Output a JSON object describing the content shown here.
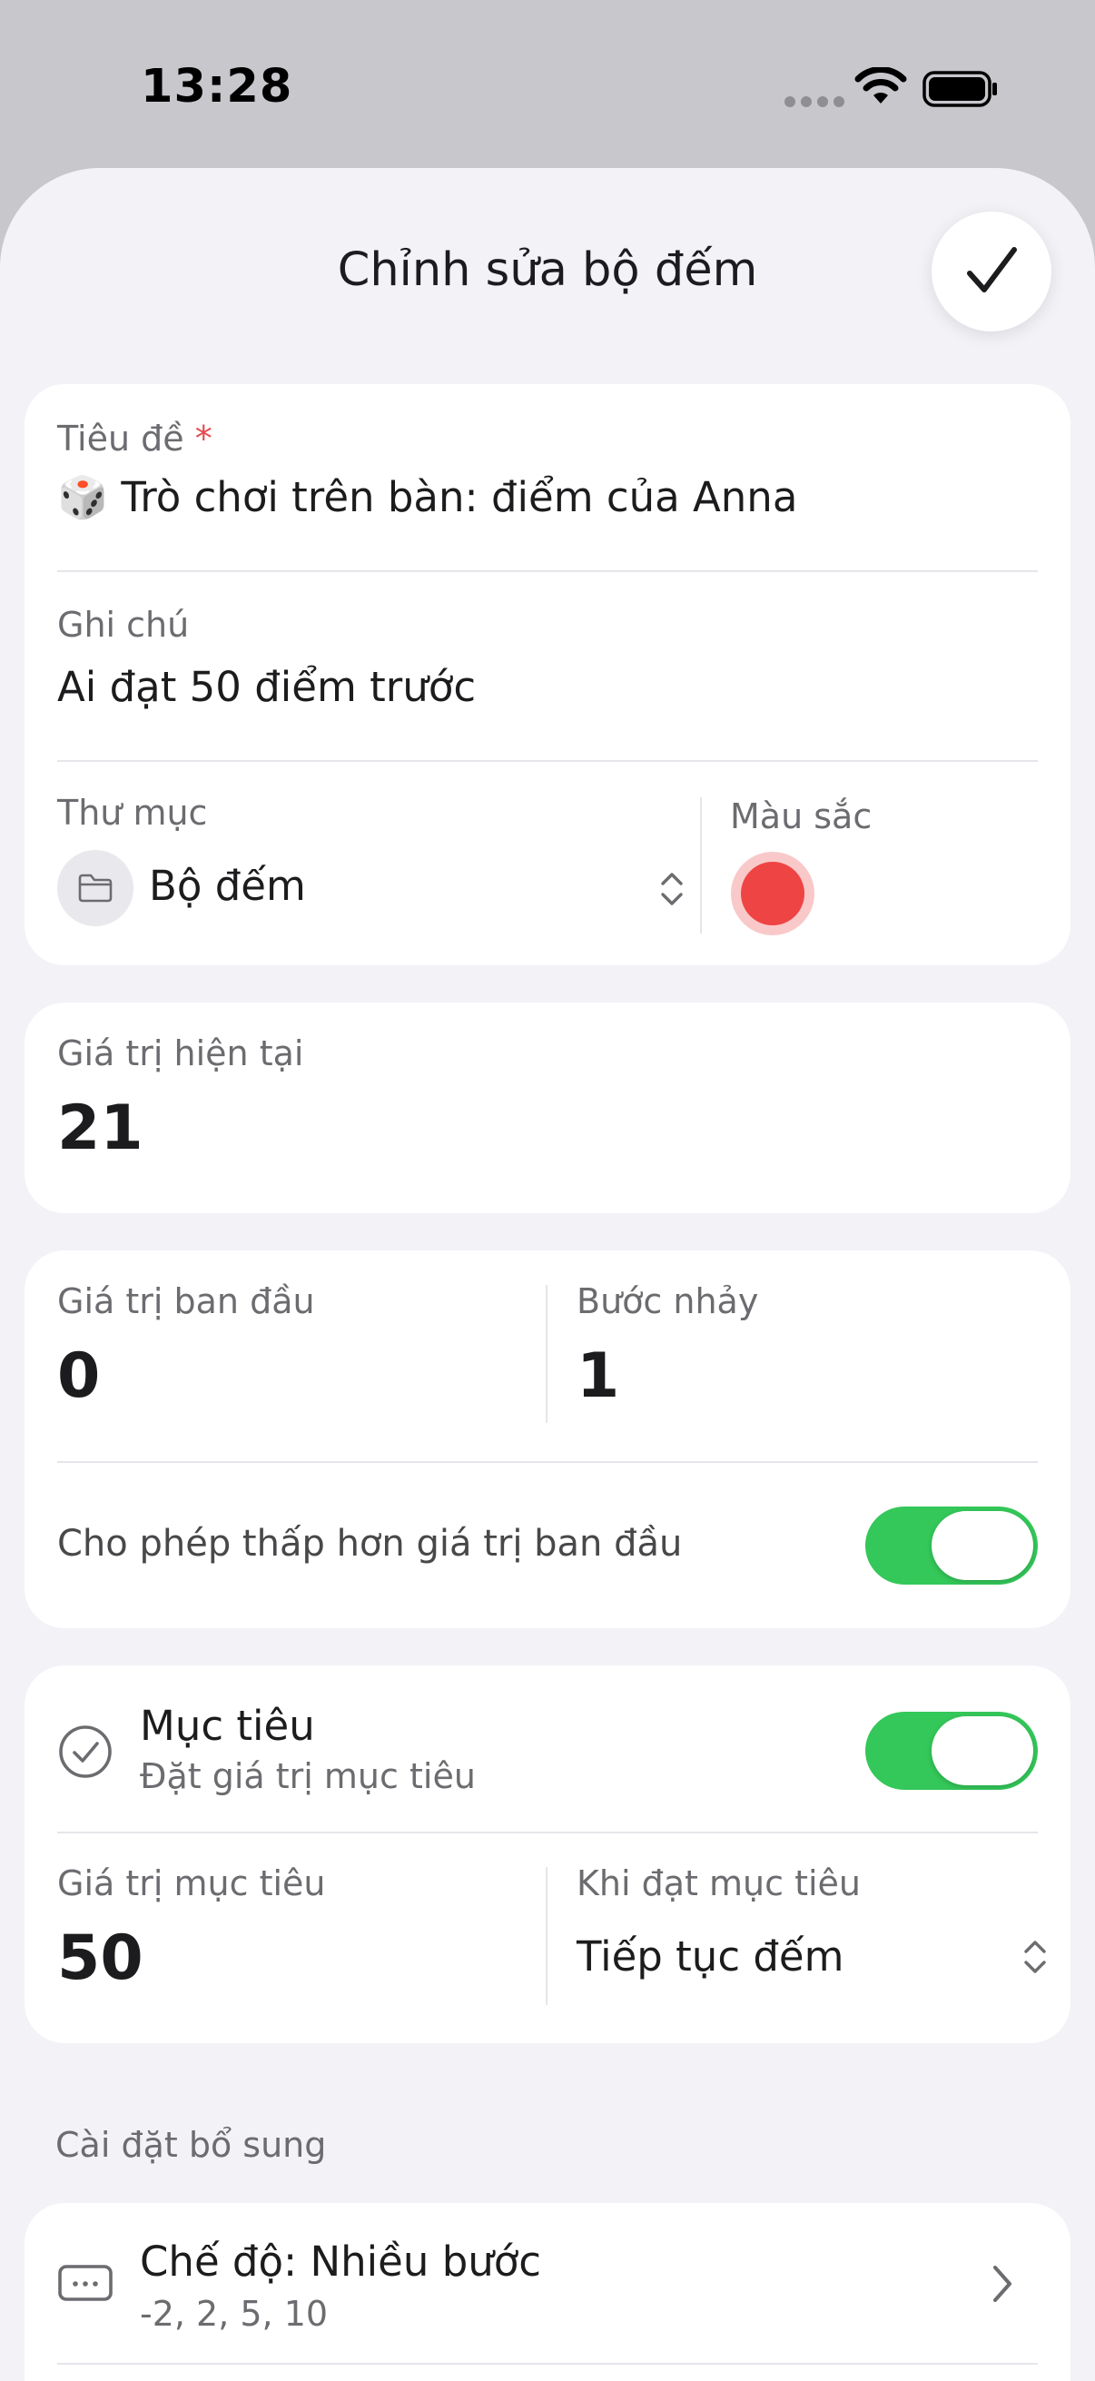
{
  "status_bar": {
    "time": "13:28"
  },
  "header": {
    "title": "Chỉnh sửa bộ đếm"
  },
  "details": {
    "title_label": "Tiêu đề",
    "required_mark": "*",
    "title_emoji": "🎲",
    "title_value": "Trò chơi trên bàn: điểm của Anna",
    "note_label": "Ghi chú",
    "note_value": "Ai đạt 50 điểm trước",
    "folder_label": "Thư mục",
    "folder_value": "Bộ đếm",
    "color_label": "Màu sắc",
    "color_value": "#ef4444"
  },
  "current": {
    "label": "Giá trị hiện tại",
    "value": "21"
  },
  "range": {
    "initial_label": "Giá trị ban đầu",
    "initial_value": "0",
    "step_label": "Bước nhảy",
    "step_value": "1",
    "allow_below_label": "Cho phép thấp hơn giá trị ban đầu",
    "allow_below_on": true
  },
  "goal": {
    "title": "Mục tiêu",
    "subtitle": "Đặt giá trị mục tiêu",
    "enabled": true,
    "target_label": "Giá trị mục tiêu",
    "target_value": "50",
    "on_reach_label": "Khi đạt mục tiêu",
    "on_reach_value": "Tiếp tục đếm"
  },
  "extra": {
    "section_title": "Cài đặt bổ sung",
    "mode_title": "Chế độ: Nhiều bước",
    "mode_steps": "-2, 2, 5, 10"
  },
  "colors": {
    "accent_green": "#34c759",
    "sheet_bg": "#f2f2f7",
    "status_bg": "#c7c7cc"
  }
}
